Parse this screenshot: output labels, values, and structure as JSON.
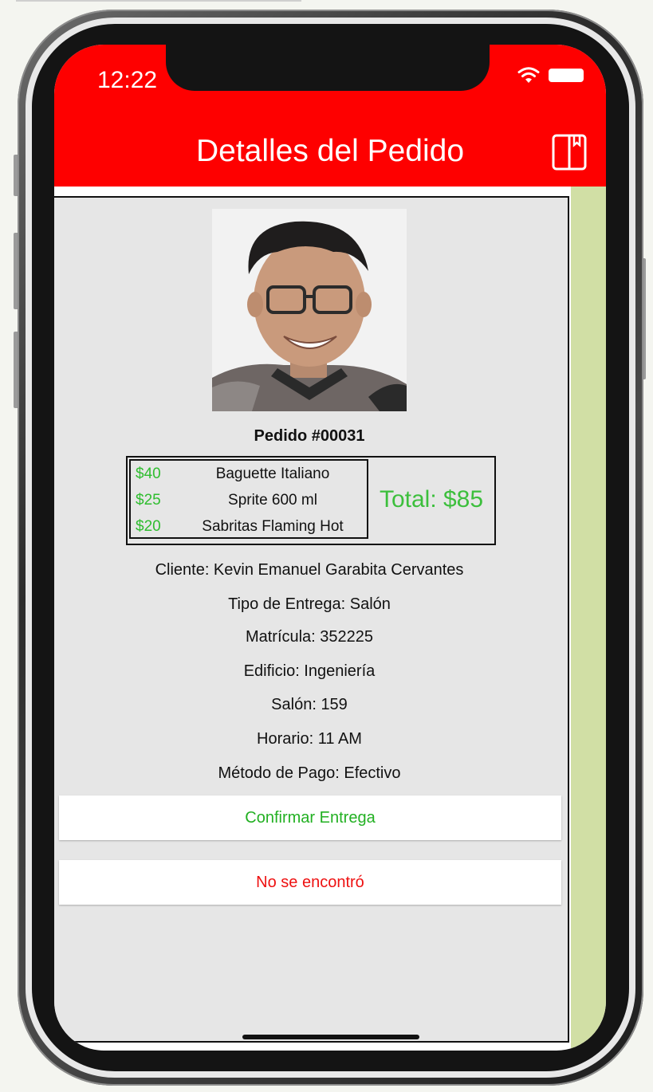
{
  "status_bar": {
    "time": "12:22"
  },
  "header": {
    "title": "Detalles del Pedido"
  },
  "order": {
    "title": "Pedido #00031",
    "items": [
      {
        "price": "$40",
        "name": "Baguette Italiano"
      },
      {
        "price": "$25",
        "name": "Sprite 600 ml"
      },
      {
        "price": "$20",
        "name": "Sabritas Flaming Hot"
      }
    ],
    "total": "Total: $85"
  },
  "details": {
    "cliente": "Cliente: Kevin Emanuel Garabita Cervantes",
    "tipo_entrega": "Tipo de Entrega: Salón",
    "matricula": "Matrícula: 352225",
    "edificio": "Edificio: Ingeniería",
    "salon": "Salón: 159",
    "horario": "Horario: 11 AM",
    "metodo_pago": "Método de Pago: Efectivo"
  },
  "actions": {
    "confirm_label": "Confirmar Entrega",
    "not_found_label": "No se encontró"
  },
  "colors": {
    "header_bg": "#fe0000",
    "side_strip": "#d1dfa5",
    "content_bg": "#e6e6e6",
    "price_green": "#2fbd2f",
    "confirm_green": "#22b022",
    "not_found_red": "#ee1111"
  },
  "icons": {
    "header_right": "book-icon",
    "status_wifi": "wifi-icon",
    "status_battery": "battery-icon"
  }
}
